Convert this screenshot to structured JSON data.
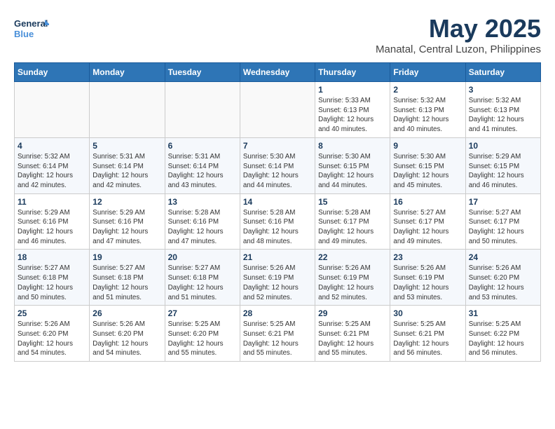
{
  "header": {
    "logo_line1": "General",
    "logo_line2": "Blue",
    "month_title": "May 2025",
    "subtitle": "Manatal, Central Luzon, Philippines"
  },
  "weekdays": [
    "Sunday",
    "Monday",
    "Tuesday",
    "Wednesday",
    "Thursday",
    "Friday",
    "Saturday"
  ],
  "weeks": [
    [
      {
        "day": "",
        "info": ""
      },
      {
        "day": "",
        "info": ""
      },
      {
        "day": "",
        "info": ""
      },
      {
        "day": "",
        "info": ""
      },
      {
        "day": "1",
        "info": "Sunrise: 5:33 AM\nSunset: 6:13 PM\nDaylight: 12 hours\nand 40 minutes."
      },
      {
        "day": "2",
        "info": "Sunrise: 5:32 AM\nSunset: 6:13 PM\nDaylight: 12 hours\nand 40 minutes."
      },
      {
        "day": "3",
        "info": "Sunrise: 5:32 AM\nSunset: 6:13 PM\nDaylight: 12 hours\nand 41 minutes."
      }
    ],
    [
      {
        "day": "4",
        "info": "Sunrise: 5:32 AM\nSunset: 6:14 PM\nDaylight: 12 hours\nand 42 minutes."
      },
      {
        "day": "5",
        "info": "Sunrise: 5:31 AM\nSunset: 6:14 PM\nDaylight: 12 hours\nand 42 minutes."
      },
      {
        "day": "6",
        "info": "Sunrise: 5:31 AM\nSunset: 6:14 PM\nDaylight: 12 hours\nand 43 minutes."
      },
      {
        "day": "7",
        "info": "Sunrise: 5:30 AM\nSunset: 6:14 PM\nDaylight: 12 hours\nand 44 minutes."
      },
      {
        "day": "8",
        "info": "Sunrise: 5:30 AM\nSunset: 6:15 PM\nDaylight: 12 hours\nand 44 minutes."
      },
      {
        "day": "9",
        "info": "Sunrise: 5:30 AM\nSunset: 6:15 PM\nDaylight: 12 hours\nand 45 minutes."
      },
      {
        "day": "10",
        "info": "Sunrise: 5:29 AM\nSunset: 6:15 PM\nDaylight: 12 hours\nand 46 minutes."
      }
    ],
    [
      {
        "day": "11",
        "info": "Sunrise: 5:29 AM\nSunset: 6:16 PM\nDaylight: 12 hours\nand 46 minutes."
      },
      {
        "day": "12",
        "info": "Sunrise: 5:29 AM\nSunset: 6:16 PM\nDaylight: 12 hours\nand 47 minutes."
      },
      {
        "day": "13",
        "info": "Sunrise: 5:28 AM\nSunset: 6:16 PM\nDaylight: 12 hours\nand 47 minutes."
      },
      {
        "day": "14",
        "info": "Sunrise: 5:28 AM\nSunset: 6:16 PM\nDaylight: 12 hours\nand 48 minutes."
      },
      {
        "day": "15",
        "info": "Sunrise: 5:28 AM\nSunset: 6:17 PM\nDaylight: 12 hours\nand 49 minutes."
      },
      {
        "day": "16",
        "info": "Sunrise: 5:27 AM\nSunset: 6:17 PM\nDaylight: 12 hours\nand 49 minutes."
      },
      {
        "day": "17",
        "info": "Sunrise: 5:27 AM\nSunset: 6:17 PM\nDaylight: 12 hours\nand 50 minutes."
      }
    ],
    [
      {
        "day": "18",
        "info": "Sunrise: 5:27 AM\nSunset: 6:18 PM\nDaylight: 12 hours\nand 50 minutes."
      },
      {
        "day": "19",
        "info": "Sunrise: 5:27 AM\nSunset: 6:18 PM\nDaylight: 12 hours\nand 51 minutes."
      },
      {
        "day": "20",
        "info": "Sunrise: 5:27 AM\nSunset: 6:18 PM\nDaylight: 12 hours\nand 51 minutes."
      },
      {
        "day": "21",
        "info": "Sunrise: 5:26 AM\nSunset: 6:19 PM\nDaylight: 12 hours\nand 52 minutes."
      },
      {
        "day": "22",
        "info": "Sunrise: 5:26 AM\nSunset: 6:19 PM\nDaylight: 12 hours\nand 52 minutes."
      },
      {
        "day": "23",
        "info": "Sunrise: 5:26 AM\nSunset: 6:19 PM\nDaylight: 12 hours\nand 53 minutes."
      },
      {
        "day": "24",
        "info": "Sunrise: 5:26 AM\nSunset: 6:20 PM\nDaylight: 12 hours\nand 53 minutes."
      }
    ],
    [
      {
        "day": "25",
        "info": "Sunrise: 5:26 AM\nSunset: 6:20 PM\nDaylight: 12 hours\nand 54 minutes."
      },
      {
        "day": "26",
        "info": "Sunrise: 5:26 AM\nSunset: 6:20 PM\nDaylight: 12 hours\nand 54 minutes."
      },
      {
        "day": "27",
        "info": "Sunrise: 5:25 AM\nSunset: 6:20 PM\nDaylight: 12 hours\nand 55 minutes."
      },
      {
        "day": "28",
        "info": "Sunrise: 5:25 AM\nSunset: 6:21 PM\nDaylight: 12 hours\nand 55 minutes."
      },
      {
        "day": "29",
        "info": "Sunrise: 5:25 AM\nSunset: 6:21 PM\nDaylight: 12 hours\nand 55 minutes."
      },
      {
        "day": "30",
        "info": "Sunrise: 5:25 AM\nSunset: 6:21 PM\nDaylight: 12 hours\nand 56 minutes."
      },
      {
        "day": "31",
        "info": "Sunrise: 5:25 AM\nSunset: 6:22 PM\nDaylight: 12 hours\nand 56 minutes."
      }
    ]
  ]
}
